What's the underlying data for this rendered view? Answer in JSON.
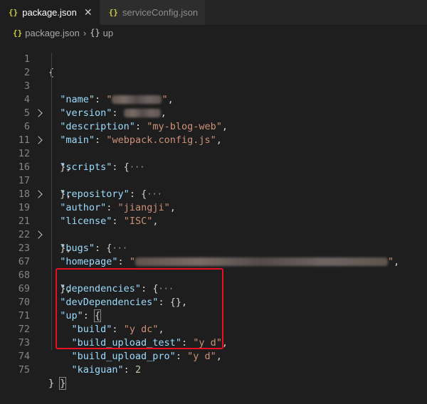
{
  "tabs": [
    {
      "icon": "{}",
      "label": "package.json",
      "active": true,
      "close": "✕"
    },
    {
      "icon": "{}",
      "label": "serviceConfig.json",
      "active": false
    }
  ],
  "breadcrumb": {
    "file_icon": "{}",
    "file": "package.json",
    "separator": "›",
    "symbol_icon": "{}",
    "symbol": "up"
  },
  "lines": [
    {
      "n": "1",
      "fold": false
    },
    {
      "n": "2",
      "fold": false,
      "key": "\"name\"",
      "val": "my-blog-web",
      "blurred": true
    },
    {
      "n": "3",
      "fold": false,
      "key": "\"version\"",
      "blurred": true
    },
    {
      "n": "4",
      "fold": false,
      "key": "\"description\"",
      "val": "\"my-blog-web\""
    },
    {
      "n": "5",
      "fold": false,
      "key": "\"main\"",
      "val": "\"webpack.config.js\""
    },
    {
      "n": "6",
      "fold": true,
      "key": "\"scripts\""
    },
    {
      "n": "11",
      "fold": false
    },
    {
      "n": "12",
      "fold": true,
      "key": "\"repository\""
    },
    {
      "n": "16",
      "fold": false
    },
    {
      "n": "17",
      "fold": false,
      "key": "\"author\"",
      "val": "\"jiangji\""
    },
    {
      "n": "18",
      "fold": false,
      "key": "\"license\"",
      "val": "\"ISC\""
    },
    {
      "n": "19",
      "fold": true,
      "key": "\"bugs\""
    },
    {
      "n": "21",
      "fold": false
    },
    {
      "n": "22",
      "fold": false,
      "key": "\"homepage\"",
      "blurred": true
    },
    {
      "n": "23",
      "fold": true,
      "key": "\"dependencies\""
    },
    {
      "n": "67",
      "fold": false
    },
    {
      "n": "68",
      "fold": false,
      "key": "\"devDependencies\""
    },
    {
      "n": "69",
      "fold": false,
      "key": "\"up\""
    },
    {
      "n": "70",
      "fold": false,
      "key": "\"build\"",
      "val": "\"y dc\""
    },
    {
      "n": "71",
      "fold": false,
      "key": "\"build_upload_test\"",
      "val": "\"y d\""
    },
    {
      "n": "72",
      "fold": false,
      "key": "\"build_upload_pro\"",
      "val": "\"y d\""
    },
    {
      "n": "73",
      "fold": false,
      "key": "\"kaiguan\"",
      "val": "2"
    },
    {
      "n": "74",
      "fold": false
    },
    {
      "n": "75",
      "fold": false
    }
  ],
  "colors": {
    "background": "#1e1e1e",
    "key": "#9cdcfe",
    "string": "#ce9178",
    "number": "#b5cea8",
    "highlight_box": "#e81123"
  }
}
